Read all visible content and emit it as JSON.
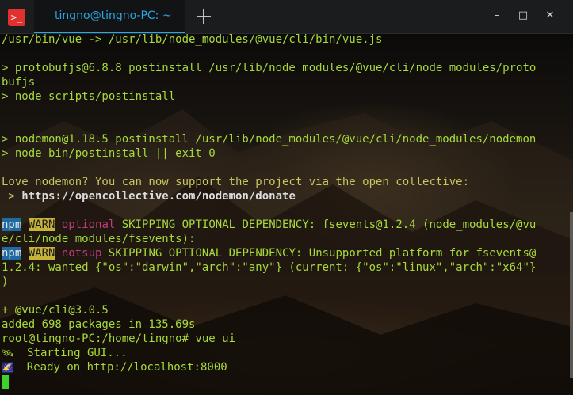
{
  "window": {
    "tab_title": "tingno@tingno-PC: ~",
    "minimize_glyph": "–",
    "maximize_glyph": "□",
    "close_glyph": "✕",
    "app_icon_glyph": ">_"
  },
  "terminal": {
    "l1": "/usr/bin/vue -> /usr/lib/node_modules/@vue/cli/bin/vue.js",
    "l3": "> protobufjs@6.8.8 postinstall /usr/lib/node_modules/@vue/cli/node_modules/proto",
    "l4": "bufjs",
    "l5": "> node scripts/postinstall",
    "l8": "> nodemon@1.18.5 postinstall /usr/lib/node_modules/@vue/cli/node_modules/nodemon",
    "l9": "> node bin/postinstall || exit 0",
    "l11": "Love nodemon? You can now support the project via the open collective:",
    "l12_prefix": " > ",
    "l12_url": "https://opencollective.com/nodemon/donate",
    "npm": "npm",
    "warn": "WARN",
    "l14_level": "optional",
    "l14_msg": " SKIPPING OPTIONAL DEPENDENCY: fsevents@1.2.4 (node_modules/@vu",
    "l15": "e/cli/node_modules/fsevents):",
    "l16_level": "notsup",
    "l16_msg": " SKIPPING OPTIONAL DEPENDENCY: Unsupported platform for fsevents@",
    "l17": "1.2.4: wanted {\"os\":\"darwin\",\"arch\":\"any\"} (current: {\"os\":\"linux\",\"arch\":\"x64\"}",
    "l18": ")",
    "l20": "+ @vue/cli@3.0.5",
    "l21": "added 698 packages in 135.69s",
    "l22": "root@tingno-PC:/home/tingno# vue ui",
    "l23_icon": "🛰",
    "l23": "  Starting GUI...",
    "l24_icon": "🌠",
    "l24": "  Ready on http://localhost:8000"
  },
  "colors": {
    "accent": "#2aa7e6",
    "text_green": "#a7d93a",
    "cursor": "#3fd12b"
  }
}
